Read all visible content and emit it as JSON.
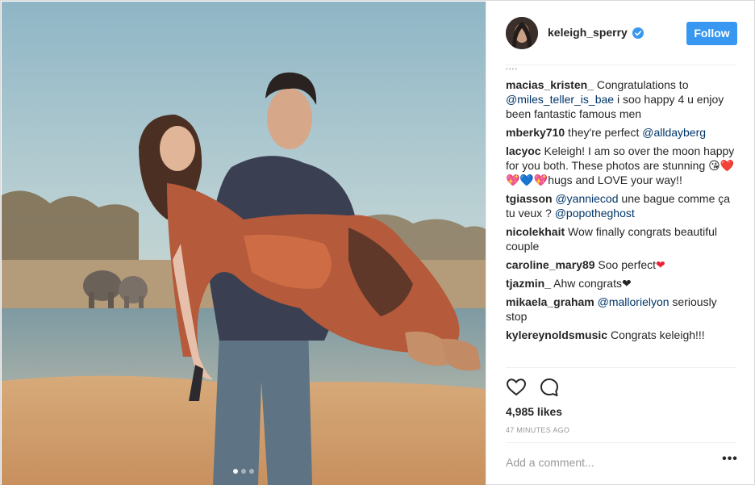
{
  "post": {
    "photo_alt": "Couple on safari",
    "carousel_count": 3,
    "carousel_active": 1
  },
  "header": {
    "username": "keleigh_sperry",
    "follow_label": "Follow",
    "verified": true
  },
  "comments": {
    "more": "....",
    "items": [
      {
        "user": "macias_kristen_",
        "parts": [
          [
            "t",
            " Congratulations to "
          ],
          [
            "m",
            "@miles_teller_is_bae"
          ],
          [
            "t",
            " i soo happy 4 u enjoy been fantastic famous men"
          ]
        ]
      },
      {
        "user": "mberky710",
        "parts": [
          [
            "t",
            " they're perfect "
          ],
          [
            "m",
            "@alldayberg"
          ]
        ]
      },
      {
        "user": "lacyoc",
        "parts": [
          [
            "t",
            " Keleigh! I am so over the moon happy for you both. These photos are stunning 😘❤️💖💙💖hugs and LOVE your way!!"
          ]
        ]
      },
      {
        "user": "tgiasson",
        "parts": [
          [
            "t",
            " "
          ],
          [
            "m",
            "@yanniecod"
          ],
          [
            "t",
            " une bague comme ça tu veux ? "
          ],
          [
            "m",
            "@popotheghost"
          ]
        ]
      },
      {
        "user": "nicolekhait",
        "parts": [
          [
            "t",
            " Wow finally congrats beautiful couple"
          ]
        ]
      },
      {
        "user": "caroline_mary89",
        "parts": [
          [
            "t",
            " Soo perfect"
          ],
          [
            "h",
            "❤"
          ]
        ]
      },
      {
        "user": "tjazmin_",
        "parts": [
          [
            "t",
            " Ahw congrats❤"
          ]
        ]
      },
      {
        "user": "mikaela_graham",
        "parts": [
          [
            "t",
            " "
          ],
          [
            "m",
            "@mallorielyon"
          ],
          [
            "t",
            " seriously stop"
          ]
        ]
      },
      {
        "user": "kylereynoldsmusic",
        "parts": [
          [
            "t",
            " Congrats keleigh!!!"
          ]
        ]
      }
    ]
  },
  "actions": {
    "like_icon": "heart-outline-icon",
    "comment_icon": "speech-bubble-icon"
  },
  "likes": "4,985 likes",
  "timestamp": "47 MINUTES AGO",
  "add_comment": {
    "placeholder": "Add a comment...",
    "value": ""
  },
  "options_label": "•••",
  "colors": {
    "follow_button": "#3897f0",
    "mention": "#003569",
    "verified": "#3897f0",
    "heart": "#e8233b"
  }
}
